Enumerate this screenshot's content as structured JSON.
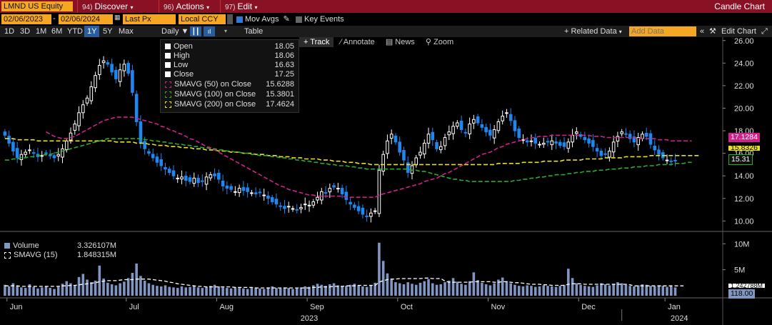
{
  "toolbar": {
    "ticker": "LMND US Equity",
    "date_start": "02/06/2023",
    "date_end": "02/06/2024",
    "price_field": "Last Px",
    "currency": "Local CCY",
    "discover_num": "94)",
    "discover": "Discover",
    "actions_num": "96)",
    "actions": "Actions",
    "edit_num": "97)",
    "edit": "Edit",
    "chart_type": "Candle Chart",
    "mov_avgs": "Mov Avgs",
    "key_events": "Key Events",
    "periods": [
      "1D",
      "3D",
      "1M",
      "6M",
      "YTD",
      "1Y",
      "5Y",
      "Max"
    ],
    "selected_period": "1Y",
    "frequency": "Daily",
    "table": "Table",
    "related_data": "+ Related Data",
    "add_data_placeholder": "Add Data",
    "edit_chart": "Edit Chart"
  },
  "chart_tools": {
    "track": "+ Track",
    "annotate": "Annotate",
    "news": "News",
    "zoom": "Zoom"
  },
  "legend": {
    "open_label": "Open",
    "open_value": "18.05",
    "high_label": "High",
    "high_value": "18.06",
    "low_label": "Low",
    "low_value": "16.63",
    "close_label": "Close",
    "close_value": "17.25",
    "sma50_label": "SMAVG (50)  on Close",
    "sma50_value": "15.6288",
    "sma100_label": "SMAVG (100)  on Close",
    "sma100_value": "15.3801",
    "sma200_label": "SMAVG (200)  on Close",
    "sma200_value": "17.4624"
  },
  "volume_legend": {
    "volume_label": "Volume",
    "volume_value": "3.326107M",
    "sma15_label": "SMAVG (15)",
    "sma15_value": "1.848315M"
  },
  "price_tags": {
    "sma200": "17.1284",
    "sma50": "15.8326",
    "last": "15.31"
  },
  "volume_tags": {
    "sma15": "1.242788M",
    "last": "118.00"
  },
  "colors": {
    "up": "#ffffff",
    "down": "#1f87f0",
    "sma50": "#d0208a",
    "sma100": "#2eaa2e",
    "sma200": "#e8e020",
    "volume": "#8296c4",
    "topbar": "#8a1024",
    "accent": "#f5a623"
  },
  "chart_data": {
    "type": "candlestick",
    "y_ticks": [
      10,
      12,
      14,
      16,
      18,
      20,
      22,
      24,
      26
    ],
    "y_tick_labels": [
      "10.00",
      "12.00",
      "14.00",
      "16.00",
      "18.00",
      "20.00",
      "22.00",
      "24.00",
      "26.00"
    ],
    "ylim": [
      9.2,
      26.3
    ],
    "volume_ticks": [
      "5M",
      "10M"
    ],
    "volume_tick_values": [
      5,
      10
    ],
    "volume_ylim": [
      0,
      11
    ],
    "x_month_labels": [
      "Jun",
      "Jul",
      "Aug",
      "Sep",
      "Oct",
      "Nov",
      "Dec",
      "Jan"
    ],
    "x_month_index": [
      1,
      30,
      52,
      74,
      96,
      118,
      140,
      161
    ],
    "x_year_labels": [
      "2023",
      "2024"
    ],
    "x_year_index": [
      74,
      164
    ],
    "n_days": 174,
    "close": [
      17.6,
      16.9,
      16.2,
      15.6,
      15.9,
      16.1,
      16.3,
      16.0,
      15.7,
      15.8,
      16.0,
      15.8,
      15.6,
      15.9,
      16.4,
      17.1,
      17.8,
      18.6,
      19.6,
      20.3,
      20.9,
      21.9,
      22.9,
      23.8,
      24.2,
      23.9,
      23.2,
      22.6,
      23.4,
      23.9,
      23.1,
      21.4,
      18.8,
      16.9,
      16.4,
      16.0,
      15.6,
      15.2,
      14.9,
      14.6,
      14.3,
      14.0,
      13.8,
      13.9,
      13.6,
      13.5,
      13.8,
      13.4,
      13.5,
      13.9,
      14.1,
      14.0,
      13.7,
      13.1,
      12.9,
      12.8,
      12.6,
      12.9,
      12.7,
      12.6,
      12.5,
      12.4,
      12.5,
      12.3,
      12.0,
      11.7,
      11.5,
      11.3,
      11.1,
      11.3,
      11.1,
      11.0,
      11.2,
      11.5,
      11.4,
      11.7,
      12.1,
      12.6,
      12.5,
      12.9,
      13.0,
      12.9,
      12.4,
      11.9,
      11.5,
      11.2,
      10.9,
      10.6,
      10.4,
      10.7,
      10.9,
      14.5,
      15.9,
      17.1,
      17.7,
      17.0,
      16.1,
      15.4,
      14.3,
      14.9,
      15.6,
      16.1,
      16.9,
      17.7,
      17.2,
      16.4,
      16.6,
      17.4,
      17.9,
      18.4,
      18.7,
      18.1,
      17.8,
      18.6,
      19.0,
      18.7,
      18.3,
      17.9,
      17.6,
      18.1,
      18.8,
      19.3,
      19.6,
      18.9,
      18.0,
      17.4,
      17.2,
      17.0,
      17.1,
      16.9,
      16.8,
      16.9,
      17.0,
      17.1,
      16.9,
      16.7,
      16.6,
      17.0,
      17.6,
      17.9,
      17.5,
      17.2,
      16.9,
      16.6,
      16.2,
      15.8,
      15.9,
      16.2,
      17.0,
      17.5,
      17.9,
      17.7,
      17.3,
      17.0,
      17.4,
      17.7,
      17.5,
      16.8,
      16.3,
      15.9,
      15.6,
      15.4,
      15.3,
      15.31
    ],
    "volume": [
      2.1,
      1.8,
      2.4,
      1.9,
      1.6,
      1.5,
      2.2,
      1.7,
      1.4,
      1.6,
      1.8,
      1.5,
      1.3,
      1.7,
      2.3,
      2.8,
      2.4,
      2.0,
      3.6,
      4.2,
      3.1,
      2.6,
      2.9,
      5.8,
      3.3,
      2.5,
      2.2,
      2.0,
      2.4,
      2.7,
      3.4,
      4.4,
      6.2,
      3.8,
      2.9,
      2.4,
      2.1,
      1.9,
      1.8,
      2.0,
      1.7,
      1.6,
      1.5,
      1.8,
      1.6,
      1.7,
      1.9,
      1.6,
      1.5,
      1.7,
      1.9,
      2.1,
      1.8,
      1.6,
      1.5,
      1.4,
      1.6,
      1.5,
      1.4,
      1.3,
      1.5,
      1.6,
      1.4,
      1.3,
      1.6,
      1.8,
      1.5,
      1.4,
      1.6,
      1.5,
      1.3,
      1.4,
      1.6,
      1.8,
      1.7,
      2.0,
      2.3,
      2.1,
      1.9,
      2.2,
      2.4,
      2.0,
      1.8,
      1.9,
      2.1,
      2.3,
      2.0,
      1.8,
      1.7,
      2.0,
      2.5,
      10.2,
      6.7,
      4.3,
      3.1,
      2.6,
      2.4,
      2.2,
      2.6,
      2.3,
      2.1,
      2.5,
      2.8,
      3.2,
      2.4,
      2.1,
      2.2,
      2.6,
      2.9,
      3.4,
      2.7,
      2.3,
      2.1,
      2.8,
      4.5,
      3.0,
      2.5,
      2.2,
      2.0,
      2.4,
      3.1,
      3.5,
      2.8,
      2.4,
      2.1,
      1.9,
      1.8,
      2.0,
      1.9,
      1.7,
      1.8,
      2.0,
      1.9,
      1.8,
      1.7,
      1.9,
      2.1,
      5.2,
      3.4,
      2.4,
      2.1,
      1.9,
      1.8,
      1.7,
      2.0,
      2.4,
      2.2,
      2.0,
      2.3,
      2.6,
      2.4,
      2.1,
      1.9,
      1.8,
      2.0,
      2.2,
      2.1,
      1.9,
      1.8,
      2.0,
      1.9,
      1.7,
      2.0,
      1.6
    ],
    "sma50": [
      null,
      null,
      null,
      null,
      null,
      null,
      null,
      null,
      null,
      null,
      17.9,
      17.7,
      17.5,
      17.4,
      17.3,
      17.3,
      17.4,
      17.5,
      17.7,
      17.9,
      18.1,
      18.3,
      18.5,
      18.7,
      18.9,
      19.0,
      19.1,
      19.2,
      19.2,
      19.2,
      19.2,
      19.2,
      19.1,
      19.0,
      18.9,
      18.8,
      18.7,
      18.6,
      18.4,
      18.3,
      18.1,
      18.0,
      17.8,
      17.7,
      17.5,
      17.3,
      17.2,
      17.0,
      16.8,
      16.6,
      16.5,
      16.3,
      16.1,
      15.9,
      15.7,
      15.5,
      15.3,
      15.1,
      14.9,
      14.7,
      14.5,
      14.3,
      14.1,
      13.9,
      13.7,
      13.5,
      13.3,
      13.1,
      13.0,
      12.8,
      12.7,
      12.6,
      12.5,
      12.4,
      12.3,
      12.3,
      12.2,
      12.2,
      12.2,
      12.2,
      12.2,
      12.2,
      12.2,
      12.1,
      12.1,
      12.1,
      12.1,
      12.1,
      12.1,
      12.1,
      12.1,
      12.3,
      12.4,
      12.5,
      12.6,
      12.7,
      12.8,
      12.9,
      13.0,
      13.1,
      13.2,
      13.3,
      13.5,
      13.6,
      13.7,
      13.8,
      14.0,
      14.2,
      14.3,
      14.5,
      14.7,
      14.9,
      15.1,
      15.3,
      15.5,
      15.7,
      15.9,
      16.0,
      16.1,
      16.3,
      16.5,
      16.6,
      16.8,
      16.9,
      17.0,
      17.1,
      17.2,
      17.3,
      17.4,
      17.4,
      17.5,
      17.5,
      17.5,
      17.6,
      17.6,
      17.6,
      17.6,
      17.6,
      17.6,
      17.6,
      17.6,
      17.6,
      17.6,
      17.5,
      17.5,
      17.5,
      17.4,
      17.4,
      17.4,
      17.4,
      17.4,
      17.4,
      17.4,
      17.4,
      17.3,
      17.3,
      17.3,
      17.3,
      17.3,
      17.2,
      17.2,
      17.2,
      17.1,
      17.1,
      17.1,
      17.1,
      17.1,
      17.1
    ],
    "sma100": [
      15.4,
      15.4,
      15.5,
      15.5,
      15.6,
      15.6,
      15.7,
      15.7,
      15.8,
      15.8,
      15.9,
      15.9,
      16.0,
      16.1,
      16.2,
      16.3,
      16.4,
      16.5,
      16.6,
      16.7,
      16.8,
      16.9,
      17.0,
      17.1,
      17.2,
      17.3,
      17.3,
      17.3,
      17.3,
      17.3,
      17.3,
      17.3,
      17.3,
      17.3,
      17.2,
      17.2,
      17.1,
      17.1,
      17.0,
      17.0,
      16.9,
      16.9,
      16.8,
      16.8,
      16.7,
      16.7,
      16.6,
      16.6,
      16.5,
      16.5,
      16.4,
      16.4,
      16.3,
      16.3,
      16.2,
      16.2,
      16.1,
      16.1,
      16.0,
      16.0,
      15.9,
      15.9,
      15.8,
      15.8,
      15.8,
      15.7,
      15.7,
      15.6,
      15.6,
      15.5,
      15.5,
      15.4,
      15.4,
      15.3,
      15.3,
      15.2,
      15.2,
      15.1,
      15.1,
      15.0,
      15.0,
      14.9,
      14.9,
      14.9,
      14.8,
      14.8,
      14.7,
      14.7,
      14.6,
      14.6,
      14.6,
      14.6,
      14.6,
      14.6,
      14.6,
      14.6,
      14.6,
      14.6,
      14.6,
      14.5,
      14.5,
      14.4,
      14.4,
      14.3,
      14.2,
      14.1,
      14.0,
      13.9,
      13.8,
      13.7,
      13.7,
      13.6,
      13.6,
      13.5,
      13.5,
      13.5,
      13.5,
      13.5,
      13.5,
      13.5,
      13.5,
      13.5,
      13.5,
      13.5,
      13.6,
      13.6,
      13.7,
      13.7,
      13.8,
      13.8,
      13.9,
      13.9,
      14.0,
      14.0,
      14.1,
      14.1,
      14.1,
      14.2,
      14.2,
      14.3,
      14.3,
      14.4,
      14.4,
      14.4,
      14.5,
      14.5,
      14.5,
      14.6,
      14.6,
      14.6,
      14.7,
      14.7,
      14.7,
      14.8,
      14.8,
      14.8,
      14.9,
      14.9,
      14.9,
      15.0,
      15.0,
      15.0,
      15.0,
      15.1,
      15.1,
      15.1,
      15.2,
      15.2
    ],
    "sma200": [
      17.3,
      17.3,
      17.3,
      17.2,
      17.2,
      17.2,
      17.2,
      17.2,
      17.1,
      17.1,
      17.1,
      17.1,
      17.1,
      17.1,
      17.1,
      17.1,
      17.1,
      17.1,
      17.1,
      17.1,
      17.1,
      17.1,
      17.1,
      17.1,
      17.1,
      17.1,
      17.1,
      17.0,
      17.0,
      17.0,
      17.0,
      17.0,
      16.9,
      16.9,
      16.9,
      16.8,
      16.8,
      16.7,
      16.7,
      16.7,
      16.6,
      16.6,
      16.6,
      16.5,
      16.5,
      16.5,
      16.4,
      16.4,
      16.4,
      16.3,
      16.3,
      16.3,
      16.2,
      16.2,
      16.2,
      16.1,
      16.1,
      16.1,
      16.0,
      16.0,
      16.0,
      15.9,
      15.9,
      15.9,
      15.8,
      15.8,
      15.8,
      15.7,
      15.7,
      15.7,
      15.6,
      15.6,
      15.6,
      15.5,
      15.5,
      15.5,
      15.5,
      15.4,
      15.4,
      15.4,
      15.3,
      15.3,
      15.3,
      15.2,
      15.2,
      15.2,
      15.1,
      15.1,
      15.1,
      15.0,
      15.0,
      15.0,
      15.0,
      15.0,
      15.0,
      15.0,
      15.0,
      15.0,
      15.0,
      15.0,
      15.0,
      15.0,
      15.0,
      15.0,
      15.0,
      15.0,
      15.0,
      15.0,
      15.0,
      15.0,
      15.0,
      15.0,
      15.0,
      15.0,
      15.0,
      15.0,
      15.0,
      15.0,
      15.0,
      15.0,
      15.1,
      15.1,
      15.1,
      15.1,
      15.1,
      15.1,
      15.2,
      15.2,
      15.2,
      15.2,
      15.2,
      15.3,
      15.3,
      15.3,
      15.3,
      15.3,
      15.4,
      15.4,
      15.4,
      15.4,
      15.4,
      15.5,
      15.5,
      15.5,
      15.5,
      15.5,
      15.6,
      15.6,
      15.6,
      15.6,
      15.6,
      15.7,
      15.7,
      15.7,
      15.7,
      15.7,
      15.7,
      15.8,
      15.8,
      15.8,
      15.8,
      15.8,
      15.8,
      15.8,
      15.8,
      15.8,
      15.8,
      15.8,
      15.8,
      15.8
    ],
    "vol_sma15": [
      1.9,
      1.9,
      1.9,
      1.9,
      1.8,
      1.8,
      1.8,
      1.8,
      1.8,
      1.8,
      1.8,
      1.8,
      1.8,
      1.8,
      1.9,
      1.9,
      2.0,
      2.0,
      2.1,
      2.2,
      2.3,
      2.4,
      2.5,
      2.7,
      2.8,
      2.9,
      2.9,
      2.9,
      3.0,
      3.1,
      3.1,
      3.1,
      3.2,
      3.2,
      3.2,
      3.2,
      3.1,
      3.0,
      2.9,
      2.8,
      2.6,
      2.5,
      2.3,
      2.2,
      2.1,
      2.0,
      1.9,
      1.8,
      1.8,
      1.7,
      1.7,
      1.7,
      1.7,
      1.7,
      1.7,
      1.7,
      1.6,
      1.6,
      1.6,
      1.6,
      1.6,
      1.5,
      1.5,
      1.5,
      1.5,
      1.5,
      1.5,
      1.5,
      1.5,
      1.5,
      1.5,
      1.5,
      1.5,
      1.5,
      1.5,
      1.6,
      1.6,
      1.7,
      1.7,
      1.7,
      1.8,
      1.8,
      1.8,
      1.9,
      1.9,
      1.9,
      2.0,
      2.0,
      2.0,
      2.0,
      2.0,
      2.6,
      2.9,
      3.1,
      3.2,
      3.2,
      3.3,
      3.3,
      3.3,
      3.3,
      3.3,
      3.3,
      3.4,
      3.4,
      3.3,
      3.3,
      3.3,
      2.8,
      2.6,
      2.6,
      2.6,
      2.6,
      2.6,
      2.6,
      2.7,
      2.7,
      2.7,
      2.7,
      2.7,
      2.6,
      2.6,
      2.7,
      2.7,
      2.6,
      2.5,
      2.5,
      2.4,
      2.3,
      2.2,
      2.2,
      2.2,
      2.1,
      2.1,
      2.0,
      2.0,
      2.0,
      2.0,
      2.2,
      2.3,
      2.3,
      2.3,
      2.2,
      2.2,
      2.2,
      2.2,
      2.2,
      2.2,
      2.2,
      2.2,
      2.2,
      2.2,
      2.2,
      2.1,
      1.9,
      1.9,
      1.9,
      1.9,
      1.9,
      1.9,
      1.9,
      1.9,
      1.9,
      1.9,
      1.9,
      1.9,
      1.9
    ]
  }
}
